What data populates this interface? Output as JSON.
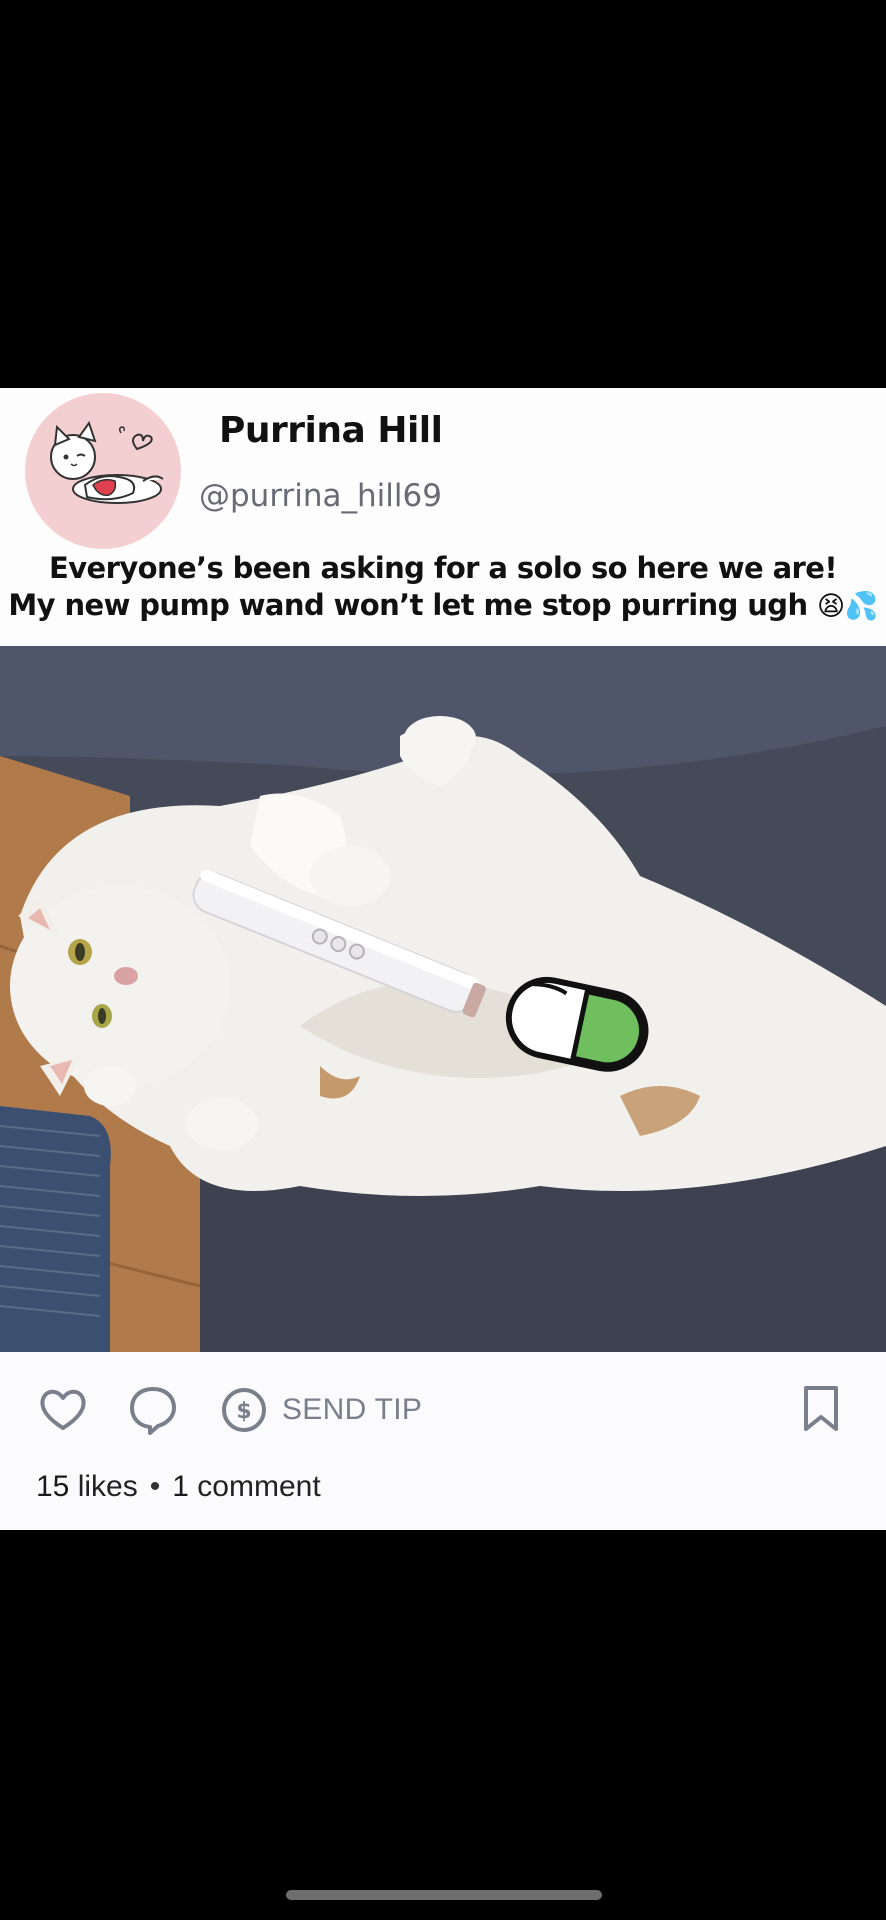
{
  "post": {
    "display_name": "Purrina Hill",
    "handle": "@purrina_hill69",
    "caption_line1": "Everyone’s been asking for a solo so here we are!",
    "caption_line2": "My new pump wand won’t let me stop purring ugh",
    "caption_emoji": "😫💦",
    "photo_icon": "cat-photo",
    "avatar_icon": "cat-avatar-icon"
  },
  "actions": {
    "like_icon": "heart-icon",
    "comment_icon": "comment-bubble-icon",
    "tip_icon": "dollar-circle-icon",
    "send_tip_label": "SEND TIP",
    "bookmark_icon": "bookmark-icon"
  },
  "stats": {
    "likes_count": "15",
    "likes_label": "likes",
    "separator": "•",
    "comments_count": "1",
    "comments_label": "comment"
  },
  "colors": {
    "background": "#000000",
    "card": "#fbfbfd",
    "avatar_bg": "#f4cfd1",
    "icon_gray": "#7a7f8c",
    "text": "#111111"
  }
}
